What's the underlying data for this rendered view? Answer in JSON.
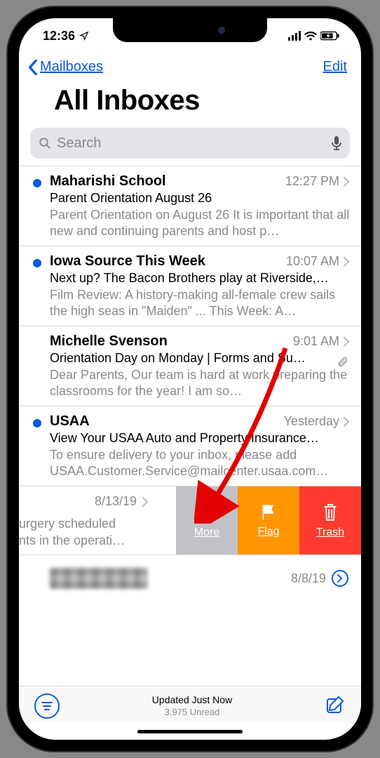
{
  "status": {
    "time": "12:36"
  },
  "nav": {
    "back": "Mailboxes",
    "edit": "Edit"
  },
  "title": "All Inboxes",
  "search": {
    "placeholder": "Search"
  },
  "emails": [
    {
      "unread": true,
      "sender": "Maharishi School",
      "time": "12:27 PM",
      "subject": "Parent Orientation August 26",
      "preview": "Parent Orientation on August 26 It is important that all new and continuing parents and host p…",
      "attachment": false
    },
    {
      "unread": true,
      "sender": "Iowa Source This Week",
      "time": "10:07 AM",
      "subject": "Next up? The Bacon Brothers play at Riverside,…",
      "preview": "Film Review: A history-making all-female crew sails the high seas in \"Maiden\" ... This Week: A…",
      "attachment": false
    },
    {
      "unread": false,
      "sender": "Michelle Svenson",
      "time": "9:01 AM",
      "subject": "Orientation Day on Monday | Forms and Su…",
      "preview": "Dear Parents, Our team is hard at work preparing the classrooms for the year! I am so…",
      "attachment": true
    },
    {
      "unread": true,
      "sender": "USAA",
      "time": "Yesterday",
      "subject": "View Your USAA Auto and Property Insurance…",
      "preview": "To ensure delivery to your inbox, please add USAA.Customer.Service@mailcenter.usaa.com…",
      "attachment": false
    }
  ],
  "swiped": {
    "date": "8/13/19",
    "preview_a": "urgery scheduled",
    "preview_b": "nts in the operati…",
    "actions": {
      "more": "More",
      "flag": "Flag",
      "trash": "Trash"
    }
  },
  "blurred": {
    "date": "8/8/19"
  },
  "toolbar": {
    "status": "Updated Just Now",
    "unread": "3,975 Unread"
  }
}
